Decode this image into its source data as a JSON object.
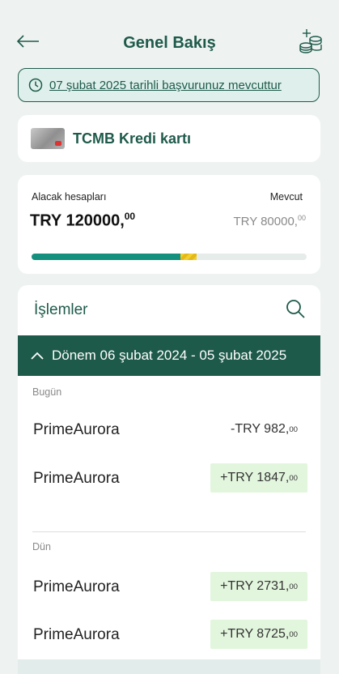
{
  "header": {
    "title": "Genel Bakış",
    "back_icon": "arrow-left-icon",
    "action_icon": "coins-plus-icon"
  },
  "banner": {
    "icon": "clock-icon",
    "text": "07 şubat 2025 tarihli başvurunuz mevcuttur"
  },
  "card": {
    "name": "TCMB Kredi kartı"
  },
  "balance": {
    "left_label": "Alacak hesapları",
    "right_label": "Mevcut",
    "main_amount": "TRY 120000,",
    "main_decimals": "00",
    "available_amount": "TRY 80000,",
    "available_decimals": "00",
    "progress_fraction": 0.6
  },
  "transactions": {
    "title": "İşlemler",
    "period": "Dönem 06 şubat 2024 - 05 şubat 2025",
    "sections": [
      {
        "label": "Bugün",
        "items": [
          {
            "name": "PrimeAurora",
            "amount": "-TRY 982,",
            "decimals": "00",
            "positive": false
          },
          {
            "name": "PrimeAurora",
            "amount": "+TRY 1847,",
            "decimals": "00",
            "positive": true
          }
        ]
      },
      {
        "label": "Dün",
        "items": [
          {
            "name": "PrimeAurora",
            "amount": "+TRY 2731,",
            "decimals": "00",
            "positive": true
          },
          {
            "name": "PrimeAurora",
            "amount": "+TRY 8725,",
            "decimals": "00",
            "positive": true
          }
        ]
      }
    ]
  },
  "colors": {
    "brand": "#1e5a4a",
    "progress": "#15907f",
    "positive_bg": "#e2f5dd"
  }
}
